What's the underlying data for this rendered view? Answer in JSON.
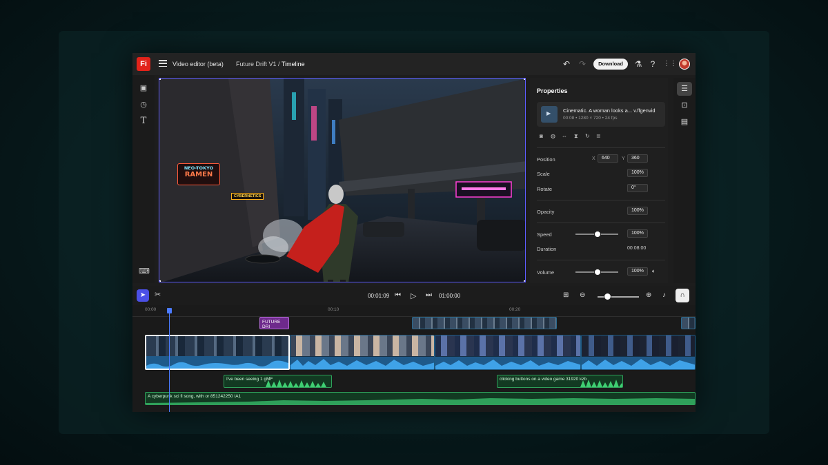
{
  "app": {
    "logo_text": "Fi",
    "title": "Video editor (beta)",
    "project_name": "Future Drift V1",
    "separator": "/",
    "current_view": "Timeline",
    "download_label": "Download"
  },
  "properties": {
    "heading": "Properties",
    "clip_name": "Cinematic. A woman looks a... v.ffgenvid",
    "clip_meta": "00:08 • 1280 × 720 • 24 fps",
    "position_label": "Position",
    "x_letter": "X",
    "x_value": "640",
    "y_letter": "Y",
    "y_value": "360",
    "scale_label": "Scale",
    "scale_value": "100%",
    "rotate_label": "Rotate",
    "rotate_value": "0°",
    "opacity_label": "Opacity",
    "opacity_value": "100%",
    "speed_label": "Speed",
    "speed_value": "100%",
    "speed_slider": 0.5,
    "duration_label": "Duration",
    "duration_value": "00:08:00",
    "volume_label": "Volume",
    "volume_value": "100%",
    "volume_slider": 0.5
  },
  "transport": {
    "current_time": "00:01:09",
    "total_time": "01:00:00",
    "zoom_level": 0.15
  },
  "timeline": {
    "ruler_ticks": [
      "00:00",
      "00:10",
      "00:20"
    ],
    "title_clip": "FUTURE DRI",
    "audio_clip_1": "I've been seeing 1 gMF",
    "audio_clip_2": "clicking buttons on a video game 31920 kzb",
    "music_clip": "A cyberpunk sci fi song, with or 851242250 IA1"
  },
  "canvas": {
    "sign_1_line1": "NEO-TOKYO",
    "sign_1_line2": "RAMEN",
    "sign_2": "CYBERNETICS"
  },
  "colors": {
    "accent": "#4b50e6",
    "selection": "#5d5bff",
    "audio_green": "#2fa05a",
    "video_blue": "#1f5a8a",
    "title_purple": "#6e2a8c",
    "logo_red": "#e2231a"
  }
}
